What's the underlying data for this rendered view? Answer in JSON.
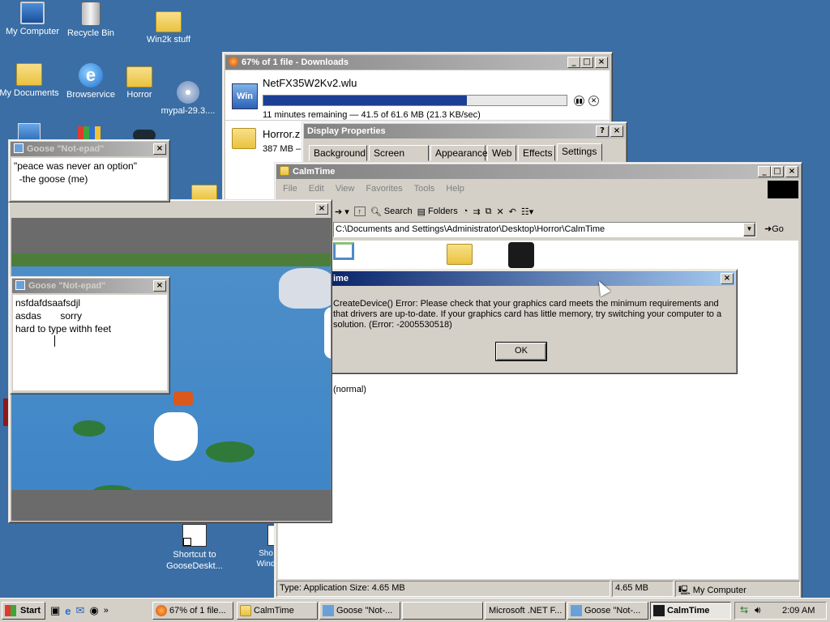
{
  "desktop": {
    "icons": [
      {
        "label": "My Computer"
      },
      {
        "label": "Recycle Bin"
      },
      {
        "label": "Win2k stuff"
      },
      {
        "label": "My Documents"
      },
      {
        "label": "Browservice"
      },
      {
        "label": "Horror"
      },
      {
        "label": "mypal-29.3...."
      },
      {
        "label": "Shortcut to GooseDeskt..."
      },
      {
        "label": "Sho Wind"
      }
    ],
    "accent": "#3a6ea5"
  },
  "downloads": {
    "title": "67% of 1 file - Downloads",
    "file1": {
      "name": "NetFX35W2Kv2.wlu",
      "status": "11 minutes remaining — 41.5 of 61.6 MB (21.3 KB/sec)",
      "progress": 0.67
    },
    "file2": {
      "name": "Horror.z",
      "status": "387 MB –"
    }
  },
  "display_props": {
    "title": "Display Properties",
    "tabs": [
      "Background",
      "Screen Saver",
      "Appearance",
      "Web",
      "Effects",
      "Settings"
    ],
    "selected_tab": "Settings"
  },
  "explorer": {
    "title": "CalmTime",
    "menu": [
      "File",
      "Edit",
      "View",
      "Favorites",
      "Tools",
      "Help"
    ],
    "toolbar": {
      "search": "Search",
      "folders": "Folders"
    },
    "address": "C:\\Documents and Settings\\Administrator\\Desktop\\Horror\\CalmTime",
    "go": "Go",
    "item_text": "(normal)",
    "status_left": "Type: Application Size: 4.65 MB",
    "status_size": "4.65 MB",
    "status_zone": "My Computer"
  },
  "error_dialog": {
    "title": "ime",
    "message": "CreateDevice() Error: Please check that your graphics card meets the minimum requirements and that drivers are up-to-date. If your graphics card has little memory, try switching your computer to a solution. (Error: -2005530518)",
    "ok": "OK"
  },
  "note1": {
    "title": "Goose \"Not-epad\"",
    "text": "\"peace was never an option\"\n  -the goose (me)"
  },
  "note2": {
    "title": "Goose \"Not-epad\"",
    "text": "nsfdafdsaafsdjl\nasdas       sorry\nhard to type withh feet"
  },
  "taskbar": {
    "start": "Start",
    "buttons": [
      "67% of 1 file...",
      "CalmTime",
      "Goose \"Not-...",
      "",
      "Microsoft .NET F...",
      "Goose \"Not-...",
      "CalmTime"
    ],
    "clock": "2:09 AM"
  }
}
